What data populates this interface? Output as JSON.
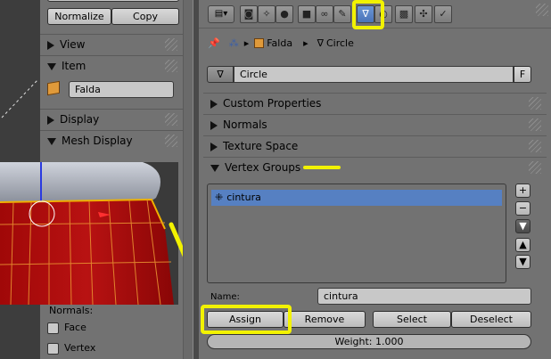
{
  "left_panel": {
    "normalize_label": "Normalize",
    "copy_label": "Copy",
    "view_label": "View",
    "item_label": "Item",
    "item_name_value": "Falda",
    "display_label": "Display",
    "mesh_display_label": "Mesh Display",
    "normals_label": "Normals:",
    "face_label": "Face",
    "vertex_label": "Vertex"
  },
  "breadcrumb": {
    "object": "Falda",
    "mesh": "Circle"
  },
  "datablock": {
    "name": "Circle",
    "fake_user": "F"
  },
  "panels": {
    "custom_properties": "Custom Properties",
    "normals": "Normals",
    "texture_space": "Texture Space",
    "vertex_groups": "Vertex Groups"
  },
  "vertex_groups": {
    "items": [
      "cintura"
    ],
    "name_label": "Name:",
    "name_value": "cintura",
    "assign_label": "Assign",
    "remove_label": "Remove",
    "select_label": "Select",
    "deselect_label": "Deselect",
    "weight_label": "Weight: 1.000"
  },
  "icons": {
    "toolbar": [
      "render-icon",
      "scene-icon",
      "world-icon",
      "object-icon",
      "constraints-icon",
      "modifier-icon",
      "mesh-data-icon",
      "material-icon",
      "texture-icon",
      "particles-icon",
      "physics-icon"
    ]
  },
  "colors": {
    "annotation": "#f2f200",
    "selection": "#5680c2",
    "mesh_red": "#b21010"
  }
}
